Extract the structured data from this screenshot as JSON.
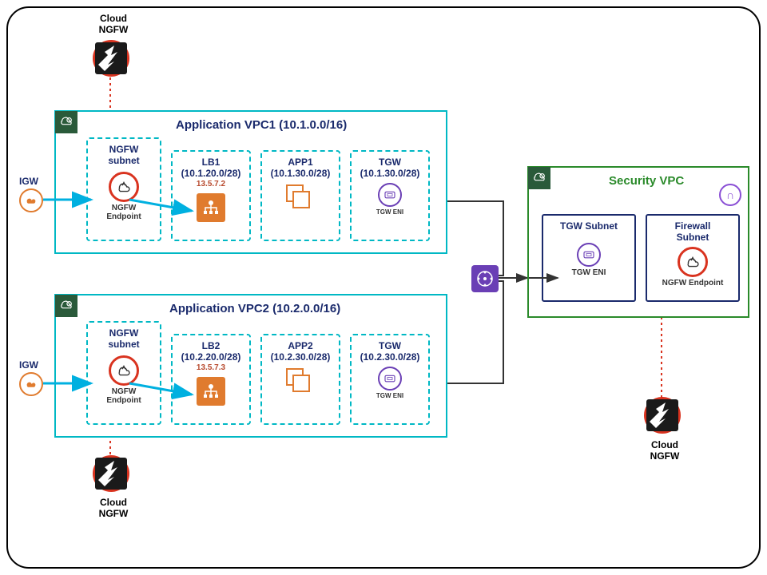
{
  "top_ngfw": {
    "label": "Cloud\nNGFW"
  },
  "bottom_ngfw": {
    "label": "Cloud\nNGFW"
  },
  "right_ngfw": {
    "label": "Cloud\nNGFW"
  },
  "vpc1": {
    "title": "Application VPC1 (10.1.0.0/16)",
    "igw_label": "IGW",
    "ngfw_subnet": {
      "title": "NGFW\nsubnet",
      "caption": "NGFW\nEndpoint"
    },
    "lb": {
      "title": "LB1",
      "cidr": "(10.1.20.0/28)",
      "ip": "13.5.7.2"
    },
    "app": {
      "title": "APP1",
      "cidr": "(10.1.30.0/28)"
    },
    "tgw": {
      "title": "TGW",
      "cidr": "(10.1.30.0/28)",
      "caption": "TGW ENI"
    }
  },
  "vpc2": {
    "title": "Application VPC2 (10.2.0.0/16)",
    "igw_label": "IGW",
    "ngfw_subnet": {
      "title": "NGFW\nsubnet",
      "caption": "NGFW\nEndpoint"
    },
    "lb": {
      "title": "LB2",
      "cidr": "(10.2.20.0/28)",
      "ip": "13.5.7.3"
    },
    "app": {
      "title": "APP2",
      "cidr": "(10.2.30.0/28)"
    },
    "tgw": {
      "title": "TGW",
      "cidr": "(10.2.30.0/28)",
      "caption": "TGW ENI"
    }
  },
  "secvpc": {
    "title": "Security VPC",
    "tgw_subnet": {
      "title": "TGW Subnet",
      "caption": "TGW ENI"
    },
    "fw_subnet": {
      "title": "Firewall\nSubnet",
      "caption": "NGFW Endpoint"
    }
  }
}
